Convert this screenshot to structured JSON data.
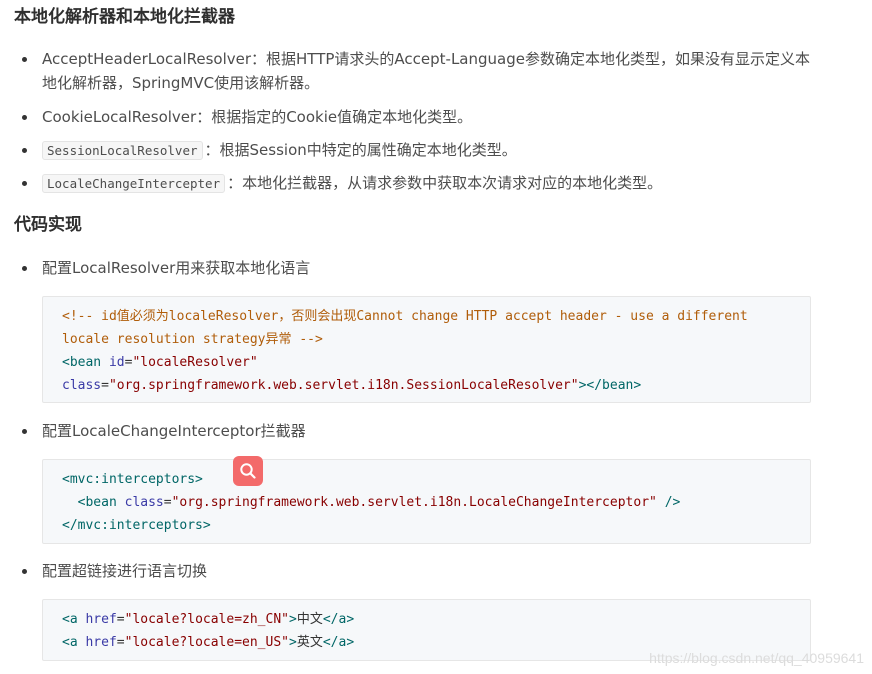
{
  "section1": {
    "title": "本地化解析器和本地化拦截器",
    "items": [
      {
        "text": "AcceptHeaderLocalResolver：根据HTTP请求头的Accept-Language参数确定本地化类型，如果没有显示定义本地化解析器，SpringMVC使用该解析器。"
      },
      {
        "text": "CookieLocalResolver：根据指定的Cookie值确定本地化类型。"
      },
      {
        "code": "SessionLocalResolver",
        "text": "：根据Session中特定的属性确定本地化类型。"
      },
      {
        "code": "LocaleChangeIntercepter",
        "text": "：本地化拦截器，从请求参数中获取本次请求对应的本地化类型。"
      }
    ]
  },
  "section2": {
    "title": "代码实现",
    "items": [
      {
        "text": "配置LocalResolver用来获取本地化语言"
      },
      {
        "text": "配置LocaleChangeInterceptor拦截器"
      },
      {
        "text": "配置超链接进行语言切换"
      }
    ]
  },
  "code1": {
    "comment_l1": "<!-- id值必须为localeResolver，否则会出现Cannot change HTTP accept header - use a different",
    "comment_l2": "locale resolution strategy异常 -->",
    "bean_open": "<bean",
    "id_attr": "id",
    "id_val": "\"localeResolver\"",
    "class_attr": "class",
    "class_val": "\"org.springframework.web.servlet.i18n.SessionLocaleResolver\"",
    "close": "></bean>"
  },
  "code2": {
    "l1": "<mvc:interceptors>",
    "bean_open": "<bean",
    "class_attr": "class",
    "class_val": "\"org.springframework.web.servlet.i18n.LocaleChangeInterceptor\"",
    "self_close": "/>",
    "l3": "</mvc:interceptors>"
  },
  "code3": {
    "a_open": "<a",
    "href_attr": "href",
    "href1": "\"locale?locale=zh_CN\"",
    "text1": "中文",
    "href2": "\"locale?locale=en_US\"",
    "text2": "英文",
    "a_close": "</a>"
  },
  "search_button_icon": "search-icon",
  "watermark": "https://blog.csdn.net/qq_40959641",
  "colors": {
    "fab": "#f36a6a",
    "code_bg": "#f6f8fa"
  }
}
